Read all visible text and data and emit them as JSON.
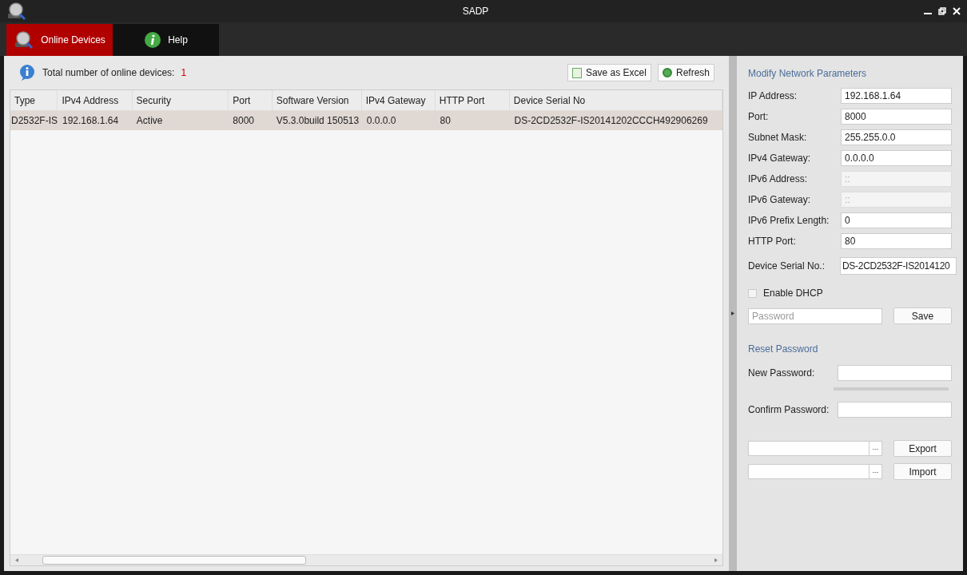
{
  "window": {
    "title": "SADP"
  },
  "tabs": [
    {
      "label": "Online Devices",
      "selected": true,
      "kind": "devices"
    },
    {
      "label": "Help",
      "selected": false,
      "kind": "help"
    }
  ],
  "summary": {
    "label": "Total number of online devices:",
    "count": "1"
  },
  "toolbar": [
    {
      "label": "Save as Excel",
      "kind": "excel"
    },
    {
      "label": "Refresh",
      "kind": "refresh"
    }
  ],
  "table": {
    "columns": [
      "Type",
      "IPv4 Address",
      "Security",
      "Port",
      "Software Version",
      "IPv4 Gateway",
      "HTTP Port",
      "Device Serial No"
    ],
    "rows": [
      {
        "selected": true,
        "cells": [
          "D2532F-IS",
          "192.168.1.64",
          "Active",
          "8000",
          "V5.3.0build 150513",
          "0.0.0.0",
          "80",
          "DS-2CD2532F-IS20141202CCCH492906269"
        ]
      }
    ]
  },
  "network": {
    "title": "Modify Network Parameters",
    "fields": [
      {
        "label": "IP Address:",
        "value": "192.168.1.64",
        "disabled": false
      },
      {
        "label": "Port:",
        "value": "8000",
        "disabled": false
      },
      {
        "label": "Subnet Mask:",
        "value": "255.255.0.0",
        "disabled": false
      },
      {
        "label": "IPv4 Gateway:",
        "value": "0.0.0.0",
        "disabled": false
      },
      {
        "label": "IPv6 Address:",
        "value": "::",
        "disabled": true
      },
      {
        "label": "IPv6 Gateway:",
        "value": "::",
        "disabled": true
      },
      {
        "label": "IPv6 Prefix Length:",
        "value": "0",
        "disabled": false
      },
      {
        "label": "HTTP Port:",
        "value": "80",
        "disabled": false
      },
      {
        "label": "Device Serial No.:",
        "value": "DS-2CD2532F-IS2014120",
        "disabled": false
      }
    ],
    "dhcp": {
      "label": "Enable DHCP",
      "checked": false
    },
    "password": {
      "placeholder": "Password"
    },
    "save": "Save"
  },
  "reset": {
    "title": "Reset Password",
    "new_label": "New Password:",
    "confirm_label": "Confirm Password:",
    "files": [
      {
        "browse": "---",
        "button": "Export"
      },
      {
        "browse": "---",
        "button": "Import"
      }
    ]
  }
}
